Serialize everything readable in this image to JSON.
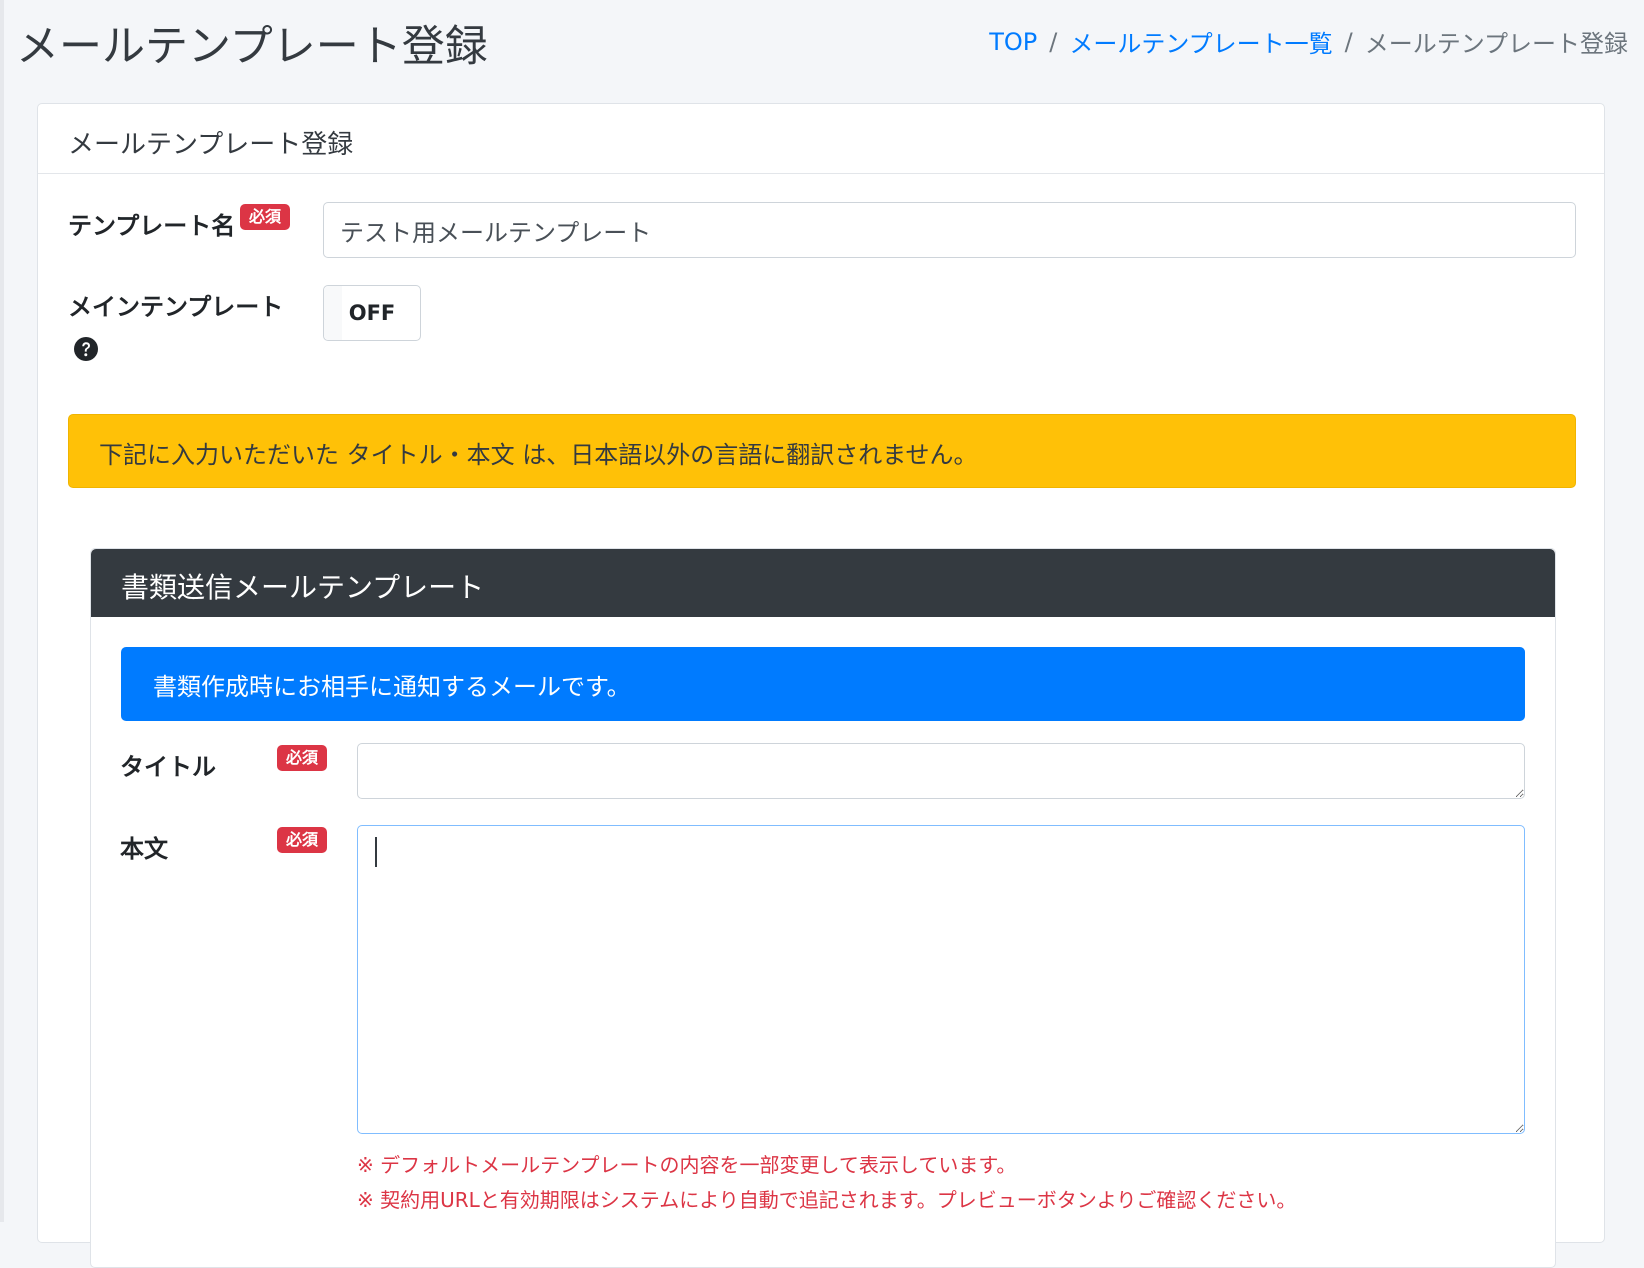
{
  "header": {
    "title": "メールテンプレート登録",
    "breadcrumb": {
      "top": "TOP",
      "list": "メールテンプレート一覧",
      "current": "メールテンプレート登録",
      "separator": "/"
    }
  },
  "card": {
    "title": "メールテンプレート登録",
    "template_name": {
      "label": "テンプレート名",
      "required_badge": "必須",
      "value": "テスト用メールテンプレート"
    },
    "main_template": {
      "label": "メインテンプレート",
      "toggle_state": "OFF",
      "help_icon": "question-circle-icon"
    },
    "warning": "下記に入力いただいた タイトル・本文 は、日本語以外の言語に翻訳されません。",
    "section": {
      "title": "書類送信メールテンプレート",
      "info": "書類作成時にお相手に通知するメールです。",
      "subject": {
        "label": "タイトル",
        "required_badge": "必須",
        "value": ""
      },
      "body": {
        "label": "本文",
        "required_badge": "必須",
        "value": ""
      },
      "notes": [
        "※ デフォルトメールテンプレートの内容を一部変更して表示しています。",
        "※ 契約用URLと有効期限はシステムにより自動で追記されます。プレビューボタンよりご確認ください。"
      ]
    }
  },
  "colors": {
    "warning": "#ffc107",
    "primary": "#007bff",
    "danger": "#dc3545",
    "dark": "#343a40"
  }
}
